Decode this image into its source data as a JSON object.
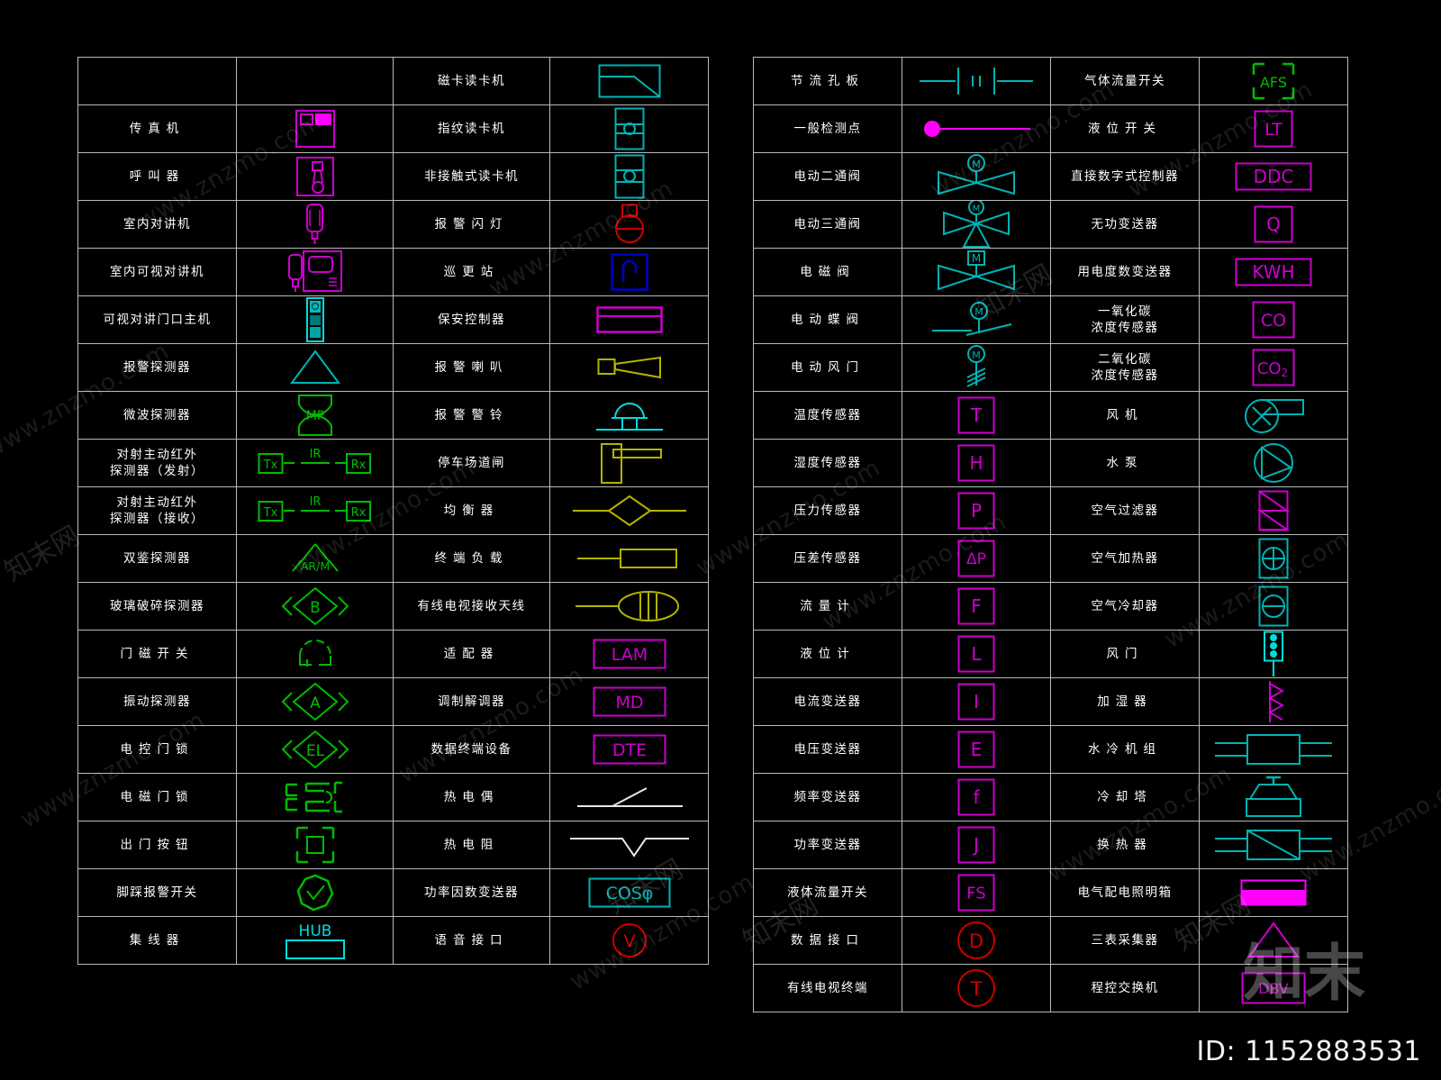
{
  "meta": {
    "id_caption": "ID: 1152883531",
    "background": "#000000",
    "grid_color": "#b9b9b9",
    "label_color": "#ffffff"
  },
  "watermarks": {
    "small_text": "www.znzmo.com",
    "brand_text": "知末",
    "brand_net": "知末网"
  },
  "colors": {
    "magenta": "#cc00cc",
    "hot_magenta": "#ff00ff",
    "cyan": "#00b3b3",
    "bright_cyan": "#00dddd",
    "green": "#00bb00",
    "red": "#cc0000",
    "blue": "#0000cc",
    "yellow": "#b3b300",
    "white": "#e6e6e6"
  },
  "left_table": {
    "rows": [
      {
        "c1": "",
        "c1_sym": "none",
        "c3": "磁卡读卡机",
        "c3_sym": "card-reader-mag-icon"
      },
      {
        "c1": "传真机",
        "c1_spaced": true,
        "c1_sym": "fax-machine-icon",
        "c3": "指纹读卡机",
        "c3_sym": "fingerprint-reader-icon"
      },
      {
        "c1": "呼叫器",
        "c1_spaced": true,
        "c1_sym": "pager-icon",
        "c3": "非接触式读卡机",
        "c3_sym": "contactless-reader-icon"
      },
      {
        "c1": "室内对讲机",
        "c1_sym": "indoor-intercom-icon",
        "c3": "报警闪灯",
        "c3_spaced": true,
        "c3_sym": "alarm-strobe-light-icon"
      },
      {
        "c1": "室内可视对讲机",
        "c1_sym": "indoor-video-intercom-icon",
        "c3": "巡更站",
        "c3_spaced": true,
        "c3_sym": "patrol-station-icon"
      },
      {
        "c1": "可视对讲门口主机",
        "c1_sym": "video-door-station-icon",
        "c3": "保安控制器",
        "c3_sym": "security-controller-icon"
      },
      {
        "c1": "报警探测器",
        "c1_sym": "alarm-detector-icon",
        "c3": "报警喇叭",
        "c3_spaced": true,
        "c3_sym": "alarm-horn-icon"
      },
      {
        "c1": "微波探测器",
        "c1_sym": "microwave-detector-icon",
        "c3": "报警警铃",
        "c3_spaced": true,
        "c3_sym": "alarm-bell-icon"
      },
      {
        "c1": "对射主动红外",
        "c1_line2": "探测器（发射）",
        "c1_sym": "ir-beam-detector-tx-icon",
        "c3": "停车场道闸",
        "c3_sym": "parking-barrier-icon"
      },
      {
        "c1": "对射主动红外",
        "c1_line2": "探测器（接收）",
        "c1_sym": "ir-beam-detector-rx-icon",
        "c3": "均衡器",
        "c3_spaced": true,
        "c3_sym": "equalizer-icon"
      },
      {
        "c1": "双鉴探测器",
        "c1_sym": "dual-tech-detector-icon",
        "c3": "终端负载",
        "c3_spaced": true,
        "c3_sym": "terminal-load-icon"
      },
      {
        "c1": "玻璃破碎探测器",
        "c1_sym": "glass-break-detector-icon",
        "c3": "有线电视接收天线",
        "c3_sym": "catv-antenna-icon"
      },
      {
        "c1": "门磁开关",
        "c1_spaced": true,
        "c1_sym": "door-contact-switch-icon",
        "c3": "适配器",
        "c3_spaced": true,
        "c3_sym": "adapter-lam-icon"
      },
      {
        "c1": "振动探测器",
        "c1_sym": "vibration-detector-icon",
        "c3": "调制解调器",
        "c3_sym": "modem-md-icon"
      },
      {
        "c1": "电控门锁",
        "c1_spaced": true,
        "c1_sym": "electric-door-lock-icon",
        "c3": "数据终端设备",
        "c3_sym": "dte-icon"
      },
      {
        "c1": "电磁门锁",
        "c1_spaced": true,
        "c1_sym": "magnetic-door-lock-icon",
        "c3": "热电偶",
        "c3_spaced": true,
        "c3_sym": "thermocouple-icon"
      },
      {
        "c1": "出门按钮",
        "c1_spaced": true,
        "c1_sym": "exit-button-icon",
        "c3": "热电阻",
        "c3_spaced": true,
        "c3_sym": "rtd-icon"
      },
      {
        "c1": "脚踩报警开关",
        "c1_sym": "foot-alarm-switch-icon",
        "c3": "功率因数变送器",
        "c3_sym": "power-factor-transducer-icon"
      },
      {
        "c1": "集线器",
        "c1_spaced": true,
        "c1_sym": "hub-icon",
        "c3": "语音接口",
        "c3_spaced": true,
        "c3_sym": "voice-interface-icon"
      }
    ]
  },
  "right_table": {
    "rows": [
      {
        "c1": "节流孔板",
        "c1_spaced": true,
        "c1_sym": "orifice-plate-icon",
        "c3": "气体流量开关",
        "c3_sym": "gas-flow-switch-afs-icon"
      },
      {
        "c1": "一般检测点",
        "c1_sym": "general-test-point-icon",
        "c3": "液位开关",
        "c3_spaced": true,
        "c3_sym": "level-switch-lt-icon"
      },
      {
        "c1": "电动二通阀",
        "c1_sym": "motorized-two-way-valve-icon",
        "c3": "直接数字式控制器",
        "c3_sym": "ddc-controller-icon"
      },
      {
        "c1": "电动三通阀",
        "c1_sym": "motorized-three-way-valve-icon",
        "c3": "无功变送器",
        "c3_sym": "reactive-power-transducer-icon"
      },
      {
        "c1": "电磁阀",
        "c1_spaced": true,
        "c1_sym": "solenoid-valve-icon",
        "c3": "用电度数变送器",
        "c3_sym": "kwh-transducer-icon"
      },
      {
        "c1": "电动蝶阀",
        "c1_spaced": true,
        "c1_sym": "motorized-butterfly-valve-icon",
        "c3": "一氧化碳",
        "c3_line2": "浓度传感器",
        "c3_sym": "co-sensor-icon"
      },
      {
        "c1": "电动风门",
        "c1_spaced": true,
        "c1_sym": "motorized-damper-icon",
        "c3": "二氧化碳",
        "c3_line2": "浓度传感器",
        "c3_sym": "co2-sensor-icon"
      },
      {
        "c1": "温度传感器",
        "c1_sym": "temperature-sensor-icon",
        "c3": "风机",
        "c3_spaced": true,
        "c3_sym": "fan-icon"
      },
      {
        "c1": "湿度传感器",
        "c1_sym": "humidity-sensor-icon",
        "c3": "水泵",
        "c3_spaced": true,
        "c3_sym": "water-pump-icon"
      },
      {
        "c1": "压力传感器",
        "c1_sym": "pressure-sensor-icon",
        "c3": "空气过滤器",
        "c3_sym": "air-filter-icon"
      },
      {
        "c1": "压差传感器",
        "c1_sym": "differential-pressure-sensor-icon",
        "c3": "空气加热器",
        "c3_sym": "air-heater-icon"
      },
      {
        "c1": "流量计",
        "c1_spaced": true,
        "c1_sym": "flow-meter-icon",
        "c3": "空气冷却器",
        "c3_sym": "air-cooler-icon"
      },
      {
        "c1": "液位计",
        "c1_spaced": true,
        "c1_sym": "level-meter-icon",
        "c3": "风门",
        "c3_spaced": true,
        "c3_sym": "damper-icon"
      },
      {
        "c1": "电流变送器",
        "c1_sym": "current-transducer-icon",
        "c3": "加湿器",
        "c3_spaced": true,
        "c3_sym": "humidifier-icon"
      },
      {
        "c1": "电压变送器",
        "c1_sym": "voltage-transducer-icon",
        "c3": "水冷机组",
        "c3_spaced": true,
        "c3_sym": "water-chiller-icon"
      },
      {
        "c1": "频率变送器",
        "c1_sym": "frequency-transducer-icon",
        "c3": "冷却塔",
        "c3_spaced": true,
        "c3_sym": "cooling-tower-icon"
      },
      {
        "c1": "功率变送器",
        "c1_sym": "power-transducer-icon",
        "c3": "换热器",
        "c3_spaced": true,
        "c3_sym": "heat-exchanger-icon"
      },
      {
        "c1": "液体流量开关",
        "c1_sym": "liquid-flow-switch-fs-icon",
        "c3": "电气配电照明箱",
        "c3_sym": "power-lighting-panel-icon"
      },
      {
        "c1": "数据接口",
        "c1_spaced": true,
        "c1_sym": "data-interface-d-icon",
        "c3": "三表采集器",
        "c3_sym": "three-meter-collector-icon"
      },
      {
        "c1": "有线电视终端",
        "c1_sym": "catv-terminal-t-icon",
        "c3": "程控交换机",
        "c3_sym": "pbx-dbv-icon"
      }
    ]
  },
  "symbol_texts": {
    "mp": "MP",
    "ir": "IR",
    "tx": "Tx",
    "rx": "Rx",
    "arm": "AR/M",
    "b": "B",
    "a": "A",
    "el": "EL",
    "hub": "HUB",
    "lam": "LAM",
    "md": "MD",
    "dte": "DTE",
    "cos": "COS",
    "phi": "φ",
    "v": "V",
    "m": "M",
    "afs": "AFS",
    "lt": "LT",
    "ddc": "DDC",
    "q": "Q",
    "kwh": "KWH",
    "co": "CO",
    "co2": "CO2",
    "t": "T",
    "h": "H",
    "p": "P",
    "dp": "ΔP",
    "f": "F",
    "l": "L",
    "i": "I",
    "e": "E",
    "f_low": "f",
    "j": "J",
    "fs": "FS",
    "d": "D",
    "t_red": "T",
    "dbv": "DBV"
  }
}
